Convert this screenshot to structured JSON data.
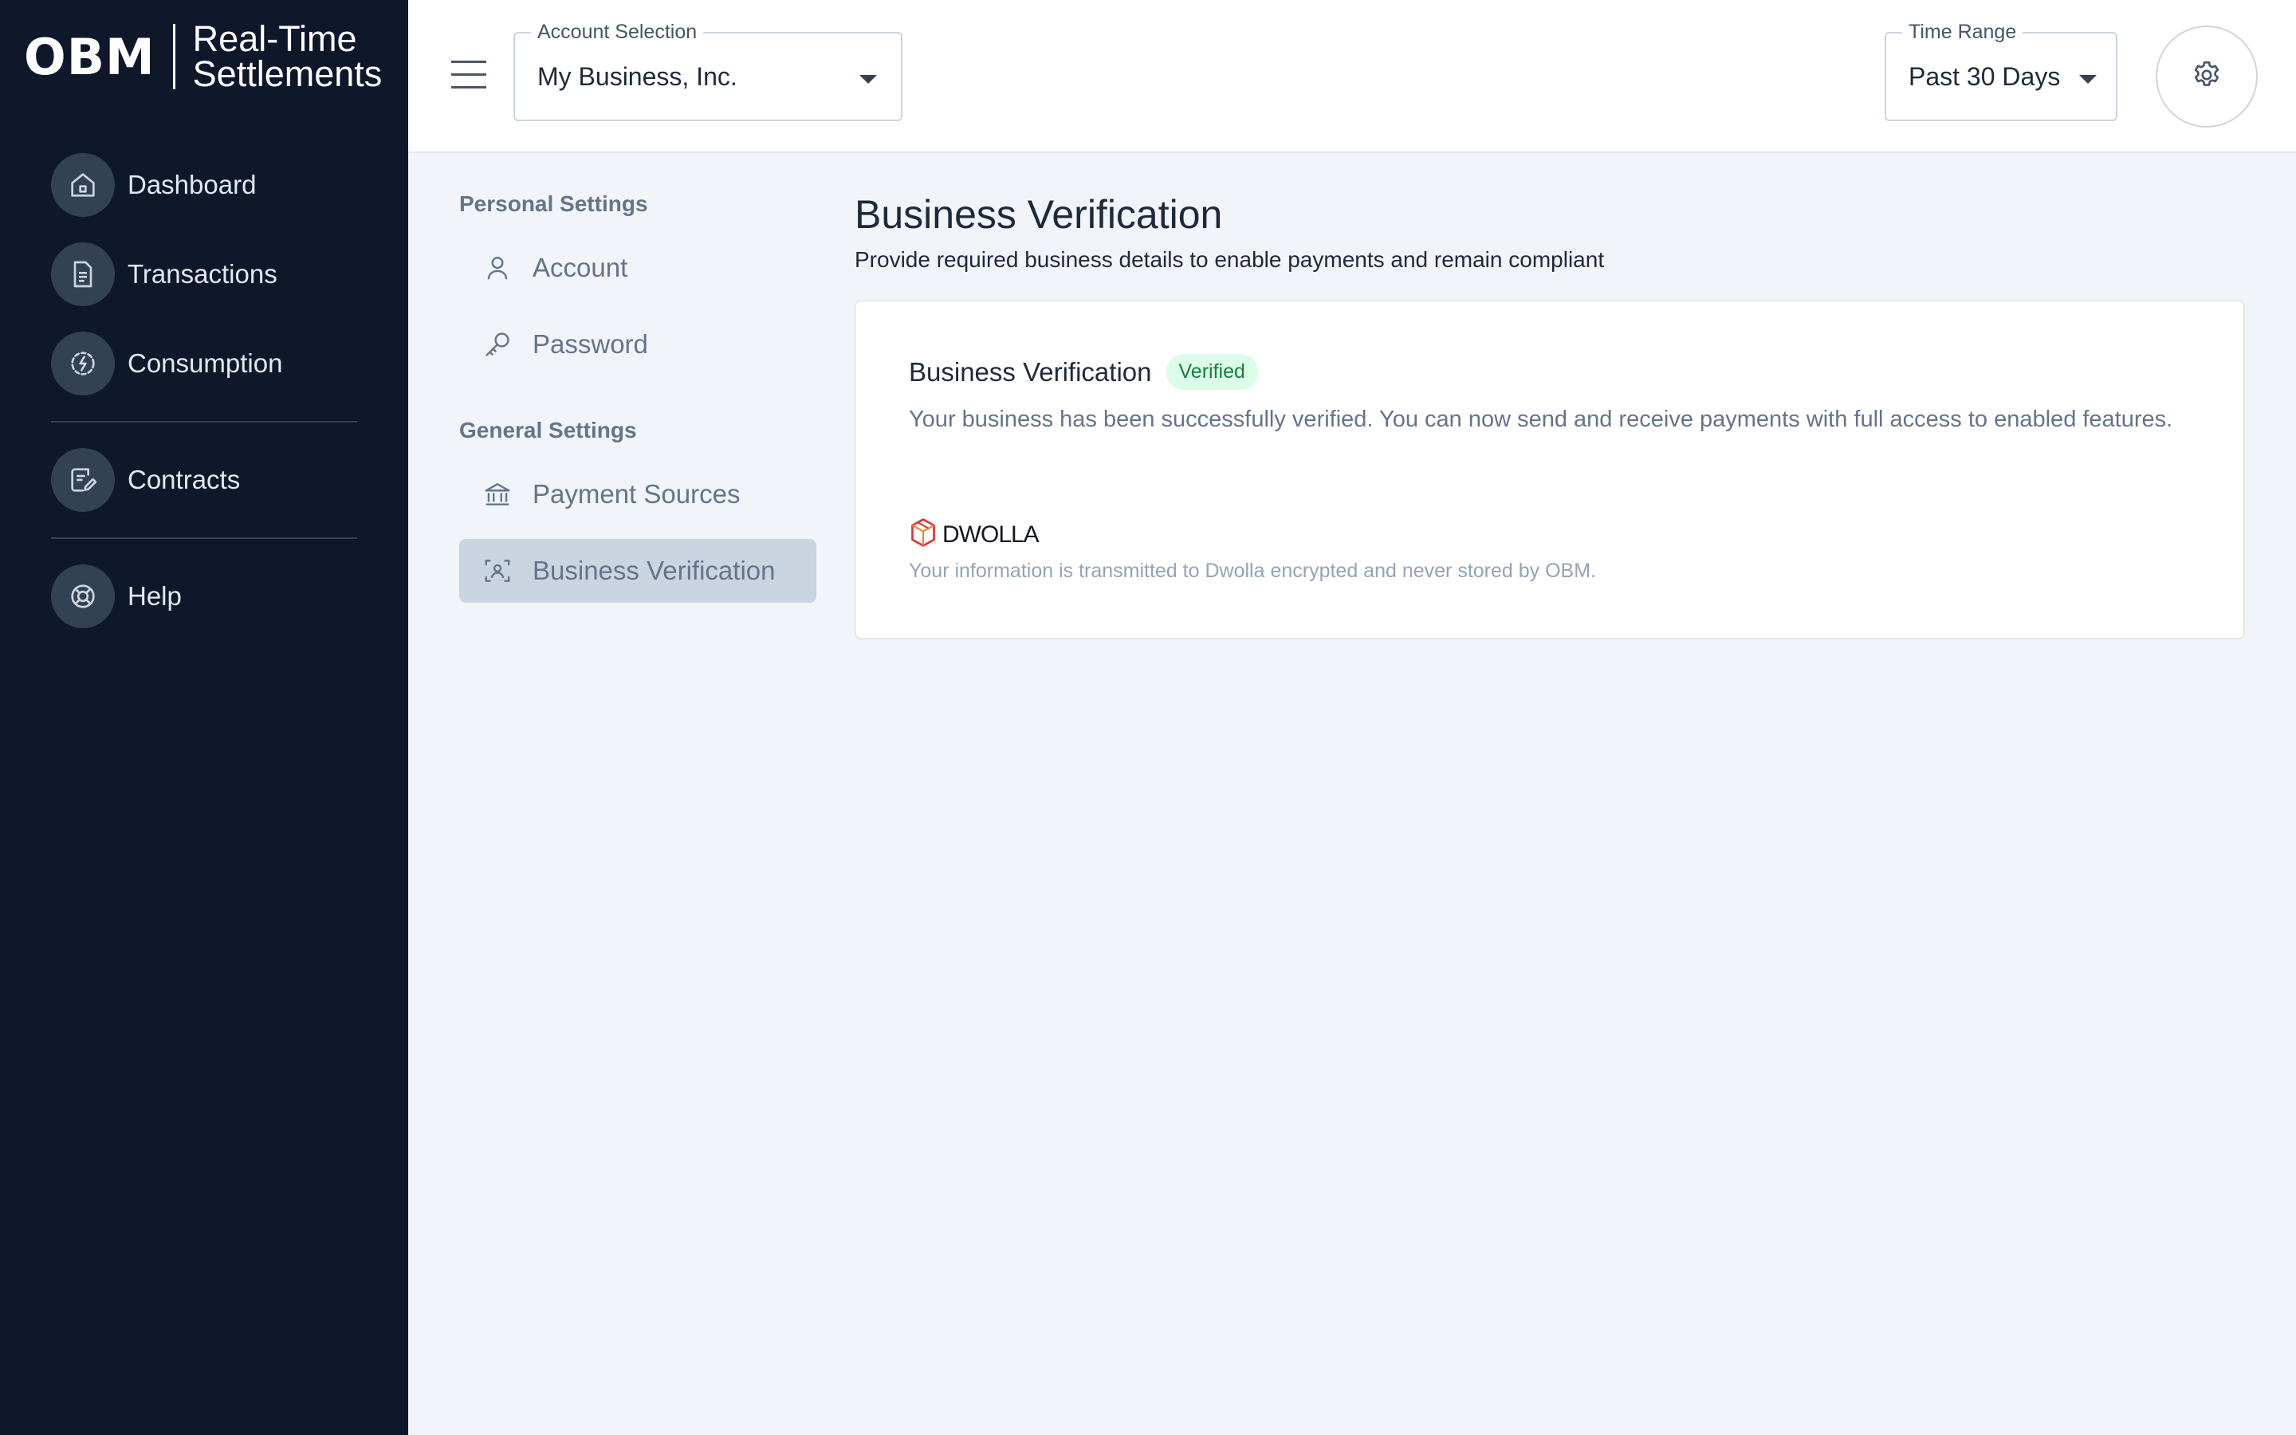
{
  "brand": {
    "logo": "OBM",
    "product_line1": "Real-Time",
    "product_line2": "Settlements"
  },
  "sidebar": {
    "items": [
      {
        "label": "Dashboard",
        "icon": "home-icon"
      },
      {
        "label": "Transactions",
        "icon": "document-icon"
      },
      {
        "label": "Consumption",
        "icon": "lightning-circle-icon"
      },
      {
        "label": "Contracts",
        "icon": "contract-icon"
      },
      {
        "label": "Help",
        "icon": "lifebuoy-icon"
      }
    ]
  },
  "topbar": {
    "account": {
      "label": "Account Selection",
      "value": "My Business, Inc."
    },
    "time_range": {
      "label": "Time Range",
      "value": "Past 30 Days"
    }
  },
  "settings_menu": {
    "personal_heading": "Personal Settings",
    "personal_items": [
      {
        "label": "Account",
        "icon": "user-icon"
      },
      {
        "label": "Password",
        "icon": "key-icon"
      }
    ],
    "general_heading": "General Settings",
    "general_items": [
      {
        "label": "Payment Sources",
        "icon": "bank-icon"
      },
      {
        "label": "Business Verification",
        "icon": "face-scan-icon",
        "active": true
      }
    ]
  },
  "main": {
    "title": "Business Verification",
    "subtitle": "Provide required business details to enable payments and remain compliant",
    "card": {
      "title": "Business Verification",
      "badge": "Verified",
      "description": "Your business has been successfully verified. You can now send and receive payments with full access to enabled features.",
      "provider": "DWOLLA",
      "note": "Your information is transmitted to Dwolla encrypted and never stored by OBM."
    }
  },
  "colors": {
    "sidebar_bg": "#0f172a",
    "page_bg": "#f1f4f8",
    "badge_bg": "#dcfce7",
    "badge_text": "#15803d",
    "dwolla_red": "#e0342f"
  }
}
